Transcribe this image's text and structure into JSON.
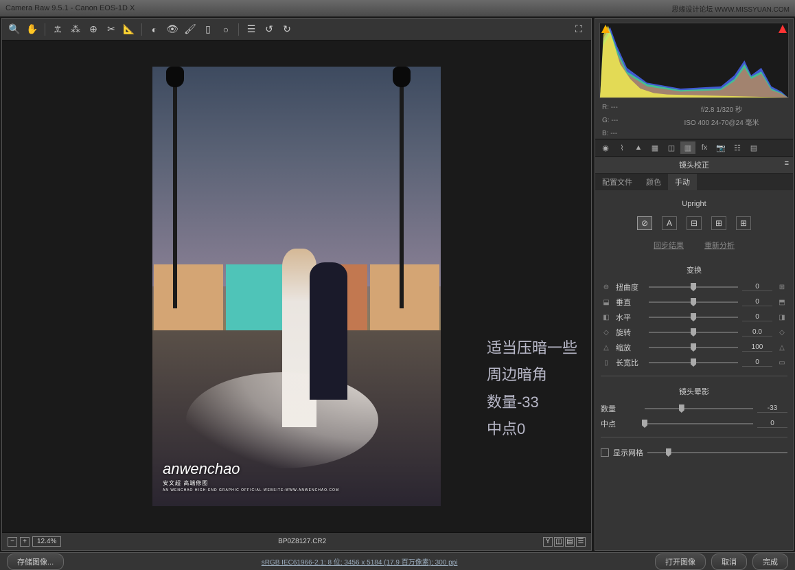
{
  "titlebar": {
    "title": "Camera Raw 9.5.1  -  Canon EOS-1D X",
    "watermark_site": "思缘设计论坛  WWW.MISSYUAN.COM"
  },
  "zoom": {
    "value": "12.4%",
    "filename": "BP0Z8127.CR2"
  },
  "histogram": {
    "r": "R:   ---",
    "g": "G:   ---",
    "b": "B:   ---",
    "exposure": "f/2.8  1/320 秒",
    "iso": "ISO 400   24-70@24 毫米"
  },
  "panel": {
    "title": "镜头校正",
    "tabs": {
      "profile": "配置文件",
      "color": "颜色",
      "manual": "手动"
    },
    "upright_label": "Upright",
    "sync": "回步结果",
    "reanalyze": "重新分析",
    "transform_label": "变换",
    "sliders": {
      "distortion": {
        "label": "扭曲度",
        "value": "0",
        "pos": 50
      },
      "vertical": {
        "label": "垂直",
        "value": "0",
        "pos": 50
      },
      "horizontal": {
        "label": "水平",
        "value": "0",
        "pos": 50
      },
      "rotate": {
        "label": "旋转",
        "value": "0.0",
        "pos": 50
      },
      "scale": {
        "label": "缩放",
        "value": "100",
        "pos": 50
      },
      "aspect": {
        "label": "长宽比",
        "value": "0",
        "pos": 50
      }
    },
    "vignette_label": "镜头晕影",
    "vignette": {
      "amount": {
        "label": "数量",
        "value": "-33",
        "pos": 34
      },
      "midpoint": {
        "label": "中点",
        "value": "0",
        "pos": 0
      }
    },
    "show_grid": "显示网格"
  },
  "annotations": {
    "l1": "适当压暗一些",
    "l2": "周边暗角",
    "l3": "数量-33",
    "l4": "中点0"
  },
  "watermark": {
    "main": "anwenchao",
    "sub1": "安文超 高端修图",
    "sub2": "AN WENCHAO HIGH-END GRAPHIC OFFICIAL WEBSITE:WWW.ANWENCHAO.COM"
  },
  "bottom": {
    "save": "存储图像...",
    "info": "sRGB IEC61966-2.1; 8 位; 3456 x 5184 (17.9 百万像素); 300 ppi",
    "open": "打开图像",
    "cancel": "取消",
    "done": "完成"
  }
}
